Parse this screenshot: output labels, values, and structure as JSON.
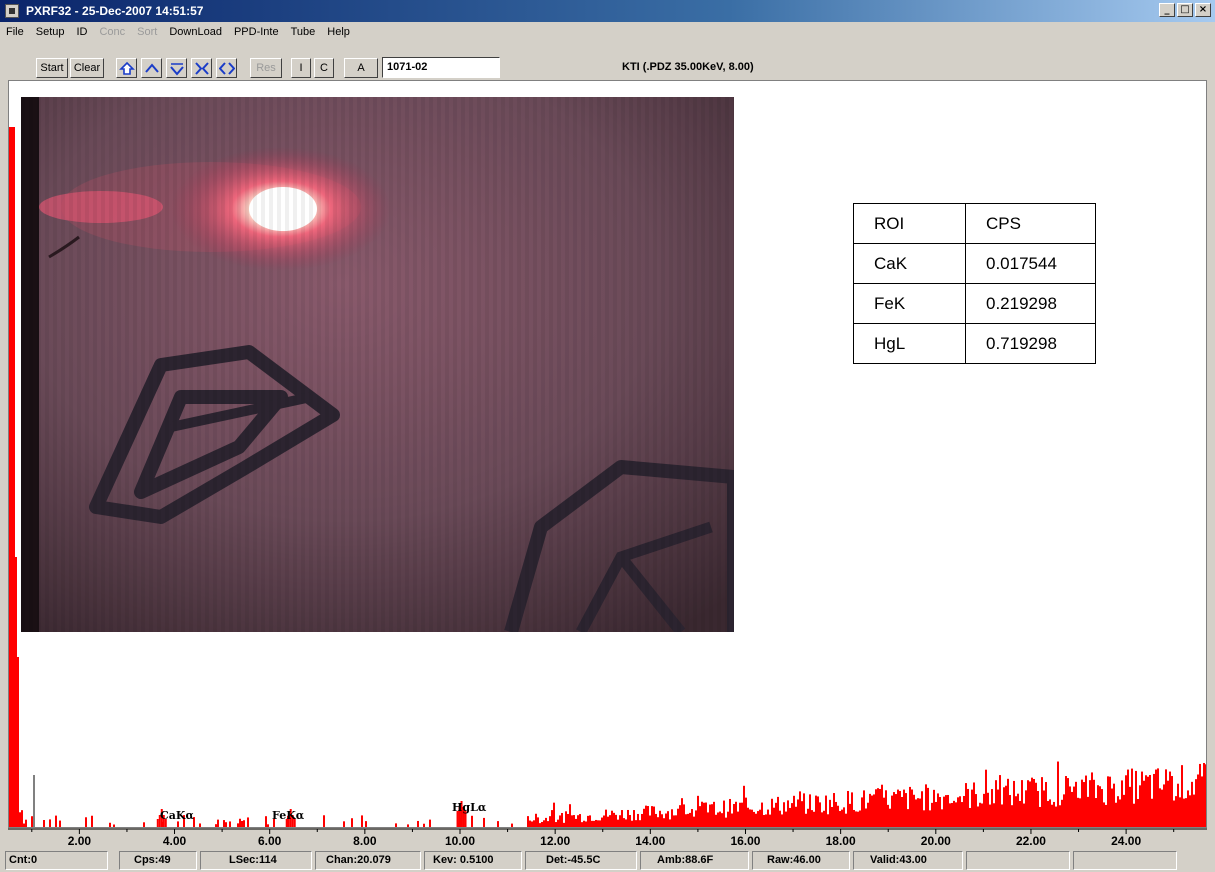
{
  "window": {
    "title": "PXRF32 - 25-Dec-2007 14:51:57",
    "controls": [
      "_",
      "□",
      "×"
    ]
  },
  "menu": [
    {
      "label": "File",
      "enabled": true
    },
    {
      "label": "Setup",
      "enabled": true
    },
    {
      "label": "ID",
      "enabled": true
    },
    {
      "label": "Conc",
      "enabled": false
    },
    {
      "label": "Sort",
      "enabled": false
    },
    {
      "label": "DownLoad",
      "enabled": true
    },
    {
      "label": "PPD-Inte",
      "enabled": true
    },
    {
      "label": "Tube",
      "enabled": true
    },
    {
      "label": "Help",
      "enabled": true
    }
  ],
  "toolbar": {
    "start_label": "Start",
    "clear_label": "Clear",
    "res_label": "Res",
    "i_label": "I",
    "c_label": "C",
    "a_label": "A",
    "sample_id": "1071-02",
    "icon_buttons": [
      "home-icon",
      "arrow-up-icon",
      "arrow-down-icon",
      "collapse-icon",
      "expand-icon"
    ],
    "tube_info": "KTI  (.PDZ 35.00KeV, 8.00)"
  },
  "roi_table": {
    "headers": [
      "ROI",
      "CPS"
    ],
    "rows": [
      [
        "CaK",
        "0.017544"
      ],
      [
        "FeK",
        "0.219298"
      ],
      [
        "HgL",
        "0.719298"
      ]
    ]
  },
  "chart_data": {
    "type": "bar",
    "xlabel": "",
    "ylabel": "",
    "xlim": [
      0.5,
      25.7
    ],
    "x_ticks": [
      "2.00",
      "4.00",
      "6.00",
      "8.00",
      "10.00",
      "12.00",
      "14.00",
      "16.00",
      "18.00",
      "20.00",
      "22.00",
      "24.00"
    ],
    "annotations": [
      {
        "label": "CaKα",
        "x": 3.69
      },
      {
        "label": "FeKα",
        "x": 6.4
      },
      {
        "label": "HgLα",
        "x": 9.99
      }
    ],
    "series_color": "#ff0000",
    "cursor_kev": 0.51
  },
  "status": [
    "Cnt:0",
    "Cps:49",
    "LSec:114",
    "Chan:20.079",
    "Kev: 0.5100",
    "Det:-45.5C",
    "Amb:88.6F",
    "Raw:46.00",
    "Valid:43.00",
    "",
    ""
  ]
}
